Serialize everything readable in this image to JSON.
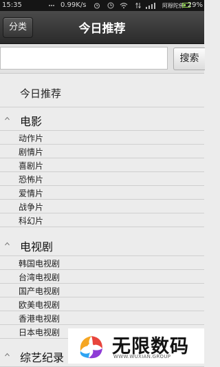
{
  "status_bar": {
    "time": "15:35",
    "speed": "0.99K/s",
    "carrier": "阿穆陀佛",
    "battery": "29%"
  },
  "header": {
    "category_button": "分类",
    "title": "今日推荐"
  },
  "search": {
    "value": "",
    "button_label": "搜索"
  },
  "today_item": "今日推荐",
  "groups": [
    {
      "title": "电影",
      "items": [
        "动作片",
        "剧情片",
        "喜剧片",
        "恐怖片",
        "爱情片",
        "战争片",
        "科幻片"
      ]
    },
    {
      "title": "电视剧",
      "items": [
        "韩国电视剧",
        "台湾电视剧",
        "国产电视剧",
        "欧美电视剧",
        "香港电视剧",
        "日本电视剧"
      ]
    },
    {
      "title": "综艺纪录",
      "items": []
    }
  ],
  "watermark": {
    "title": "无限数码",
    "subtitle": "WWW.WUXIAN.GROUP"
  },
  "colors": {
    "header_bg": "#2b2b2b",
    "page_bg": "#ececec",
    "battery": "#8fd14f"
  }
}
